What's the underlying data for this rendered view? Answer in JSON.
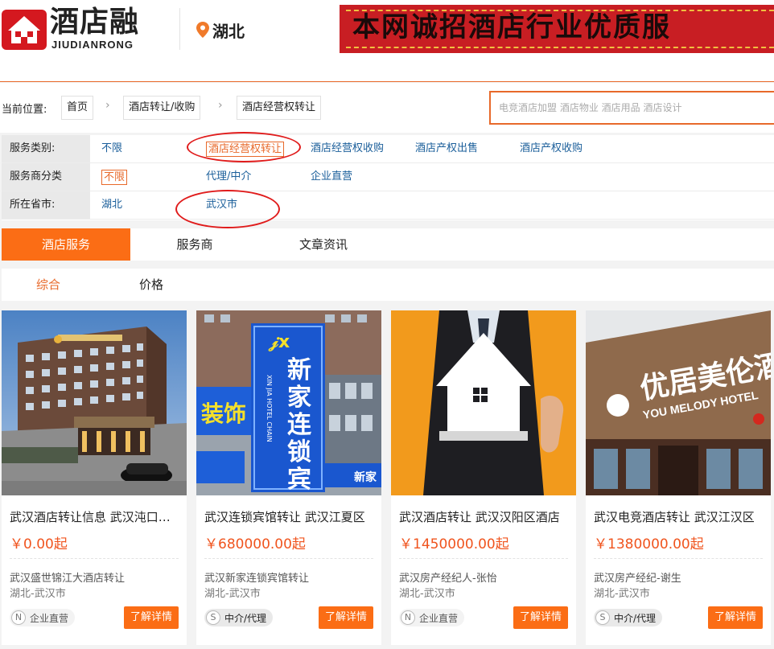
{
  "header": {
    "logo_text": "酒店融",
    "logo_sub": "JIUDIANRONG",
    "location": "湖北",
    "banner_text": "本网诚招酒店行业优质服"
  },
  "breadcrumb": {
    "label": "当前位置:",
    "items": [
      "首页",
      "酒店转让/收购",
      "酒店经营权转让"
    ],
    "arrow": "›"
  },
  "search": {
    "placeholder": "电竞酒店加盟 酒店物业 酒店用品 酒店设计"
  },
  "filters": {
    "service_type": {
      "label": "服务类别:",
      "options": [
        "不限",
        "酒店经营权转让",
        "酒店经营权收购",
        "酒店产权出售",
        "酒店产权收购"
      ],
      "selected": "酒店经营权转让"
    },
    "provider_type": {
      "label": "服务商分类",
      "options": [
        "不限",
        "代理/中介",
        "企业直营"
      ],
      "selected": "不限"
    },
    "province": {
      "label": "所在省市:",
      "options": [
        "湖北",
        "武汉市"
      ],
      "selected": "武汉市"
    }
  },
  "tabs": [
    "酒店服务",
    "服务商",
    "文章资讯"
  ],
  "sort": [
    "综合",
    "价格"
  ],
  "cards": [
    {
      "title": "武汉酒店转让信息 武汉沌口经济开发区",
      "price": "￥0.00起",
      "seller": "武汉盛世锦江大酒店转让",
      "region": "湖北-武汉市",
      "badge_icon": "N",
      "badge": "企业直营",
      "button": "了解详情"
    },
    {
      "title": "武汉连锁宾馆转让 武汉江夏区",
      "price": "￥680000.00起",
      "seller": "武汉新家连锁宾馆转让",
      "region": "湖北-武汉市",
      "badge_icon": "S",
      "badge": "中介/代理",
      "button": "了解详情"
    },
    {
      "title": "武汉酒店转让 武汉汉阳区酒店",
      "price": "￥1450000.00起",
      "seller": "武汉房产经纪人-张怡",
      "region": "湖北-武汉市",
      "badge_icon": "N",
      "badge": "企业直营",
      "button": "了解详情"
    },
    {
      "title": "武汉电竞酒店转让 武汉江汉区",
      "price": "￥1380000.00起",
      "seller": "武汉房产经纪-谢生",
      "region": "湖北-武汉市",
      "badge_icon": "S",
      "badge": "中介/代理",
      "button": "了解详情"
    }
  ],
  "image_text": {
    "hotel2_brand": "新家连锁宾馆",
    "hotel2_pinyin": "XIN JIA HOTEL CHAIN",
    "hotel2_side": "装饰",
    "hotel2_brand2": "新家",
    "hotel4_name": "优居美伦酒店",
    "hotel4_en": "YOU MELODY HOTEL"
  },
  "colors": {
    "accent": "#fb6d15",
    "price": "#f0541e",
    "link": "#1a5e9a",
    "highlight_circle": "#e01b1b"
  }
}
